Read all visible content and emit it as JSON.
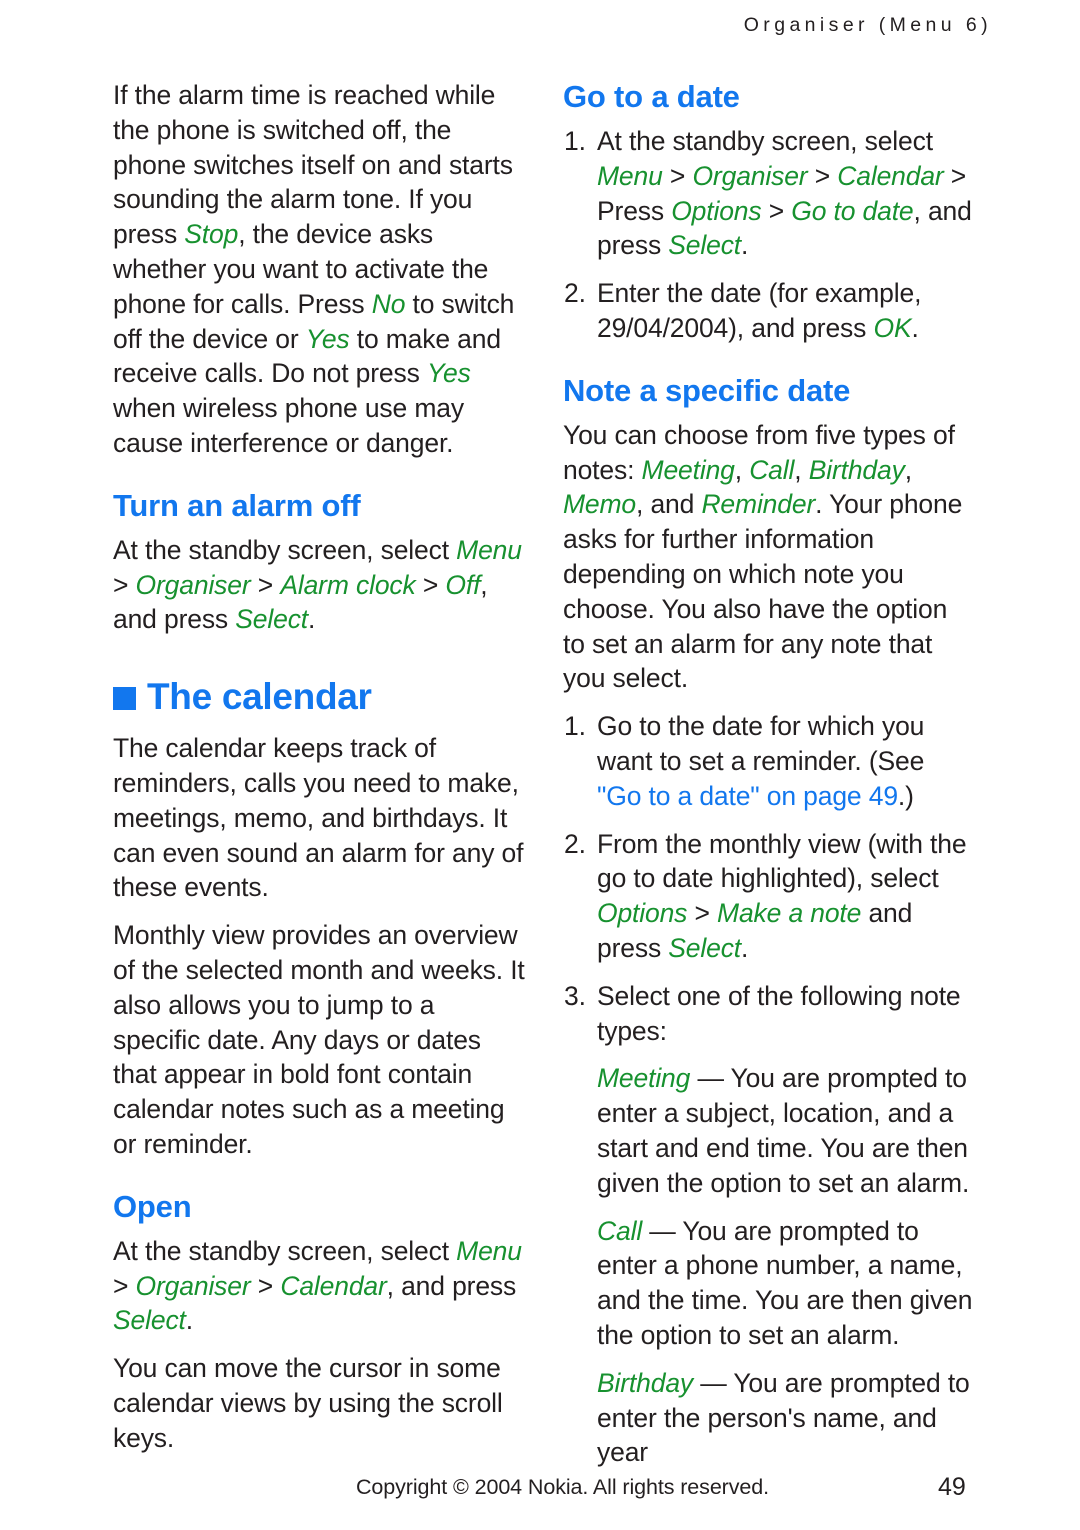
{
  "header": {
    "running_title": "Organiser (Menu 6)"
  },
  "left_column": {
    "intro_paragraph": {
      "t1": "If the alarm time is reached while the phone is switched off, the phone switches itself on and starts sounding the alarm tone. If you press ",
      "ui1": "Stop",
      "t2": ", the device asks whether you want to activate the phone for calls. Press ",
      "ui2": "No",
      "t3": " to switch off the device or ",
      "ui3": "Yes",
      "t4": " to make and receive calls. Do not press ",
      "ui4": "Yes",
      "t5": " when wireless phone use may cause interference or danger."
    },
    "turn_alarm_off": {
      "heading": "Turn an alarm off",
      "body": {
        "t1": "At the standby screen, select ",
        "ui1": "Menu",
        "sep1": " > ",
        "ui2": "Organiser",
        "sep2": " > ",
        "ui3": "Alarm clock",
        "sep3": " > ",
        "ui4": "Off",
        "t2": ", and press ",
        "ui5": "Select",
        "t3": "."
      }
    },
    "the_calendar": {
      "heading": "The calendar",
      "bullet_icon": "blue-square-bullet",
      "para1": "The calendar keeps track of reminders, calls you need to make, meetings, memo, and birthdays. It can even sound an alarm for any of these events.",
      "para2": "Monthly view provides an overview of the selected month and weeks. It also allows you to jump to a specific date. Any days or dates that appear in bold font contain calendar notes such as a meeting or reminder."
    },
    "open": {
      "heading": "Open",
      "body": {
        "t1": "At the standby screen, select ",
        "ui1": "Menu",
        "sep1": " > ",
        "ui2": "Organiser",
        "sep2": " > ",
        "ui3": "Calendar",
        "t2": ", and press ",
        "ui4": "Select",
        "t3": "."
      },
      "para2": "You can move the cursor in some calendar views by using the scroll keys."
    }
  },
  "right_column": {
    "go_to_a_date": {
      "heading": "Go to a date",
      "steps": [
        {
          "num": "1.",
          "t1": "At the standby screen, select ",
          "ui1": "Menu",
          "sep1": " > ",
          "ui2": "Organiser",
          "sep2": " > ",
          "ui3": "Calendar",
          "sep3": " > ",
          "t2": "Press ",
          "ui4": "Options",
          "sep4": " > ",
          "ui5": "Go to date",
          "t3": ", and press ",
          "ui6": "Select",
          "t4": "."
        },
        {
          "num": "2.",
          "t1": "Enter the date (for example, 29/04/2004), and press ",
          "ui1": "OK",
          "t2": "."
        }
      ]
    },
    "note_a_specific_date": {
      "heading": "Note a specific date",
      "intro": {
        "t1": "You can choose from five types of notes: ",
        "ui1": "Meeting",
        "t2": ", ",
        "ui2": "Call",
        "t3": ", ",
        "ui3": "Birthday",
        "t4": ", ",
        "ui4": "Memo",
        "t5": ", and ",
        "ui5": "Reminder",
        "t6": ". Your phone asks for further information depending on which note you choose. You also have the option to set an alarm for any note that you select."
      },
      "steps": [
        {
          "num": "1.",
          "t1": "Go to the date for which you want to set a reminder. (See ",
          "xref": "\"Go to a date\" on page 49",
          "t2": ".)"
        },
        {
          "num": "2.",
          "t1": "From the monthly view (with the go to date highlighted), select ",
          "ui1": "Options",
          "sep1": " > ",
          "ui2": "Make a note",
          "t2": " and press ",
          "ui3": "Select",
          "t3": "."
        },
        {
          "num": "3.",
          "t1": "Select one of the following note types:"
        }
      ],
      "note_types": [
        {
          "name": "Meeting",
          "dash": " — ",
          "description": "You are prompted to enter a subject, location, and a start and end time. You are then given the option to set an alarm."
        },
        {
          "name": "Call",
          "dash": " — ",
          "description": "You are prompted to enter a phone number, a name, and the time. You are then given the option to set an alarm."
        },
        {
          "name": "Birthday",
          "dash": " — ",
          "description": "You are prompted to enter the person's name, and year"
        }
      ]
    }
  },
  "footer": {
    "copyright": "Copyright © 2004 Nokia. All rights reserved.",
    "page_number": "49"
  },
  "colors": {
    "heading_blue": "#1277ee",
    "ui_green": "#17912f",
    "body_black": "#231f20",
    "xref_blue": "#1277ee"
  }
}
